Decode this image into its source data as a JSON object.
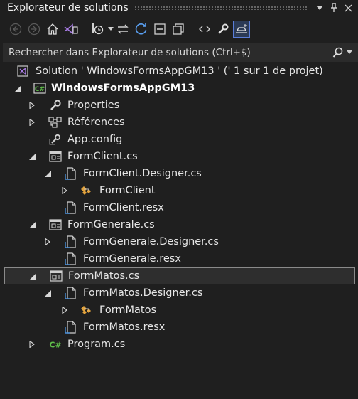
{
  "panel": {
    "title": "Explorateur de solutions"
  },
  "search": {
    "placeholder": "Rechercher dans Explorateur de solutions (Ctrl+$)"
  },
  "tree": [
    {
      "label": "Solution ' WindowsFormsAppGM13 ' (' 1 sur 1 de projet)",
      "icon": "solution-icon",
      "twisty": "none",
      "level": 0
    },
    {
      "label": "WindowsFormsAppGM13",
      "icon": "csharp-project-icon",
      "twisty": "expanded",
      "level": 0,
      "bold": true
    },
    {
      "label": "Properties",
      "icon": "wrench-icon",
      "twisty": "collapsed",
      "level": 1
    },
    {
      "label": "Références",
      "icon": "references-icon",
      "twisty": "collapsed",
      "level": 1
    },
    {
      "label": "App.config",
      "icon": "config-icon",
      "twisty": "none",
      "level": 1
    },
    {
      "label": "FormClient.cs",
      "icon": "form-icon",
      "twisty": "expanded",
      "level": 1
    },
    {
      "label": "FormClient.Designer.cs",
      "icon": "code-file-icon",
      "twisty": "expanded",
      "level": 2
    },
    {
      "label": "FormClient",
      "icon": "class-icon",
      "twisty": "collapsed",
      "level": 3
    },
    {
      "label": "FormClient.resx",
      "icon": "resx-icon",
      "twisty": "none",
      "level": 2
    },
    {
      "label": "FormGenerale.cs",
      "icon": "form-icon",
      "twisty": "expanded",
      "level": 1
    },
    {
      "label": "FormGenerale.Designer.cs",
      "icon": "code-file-icon",
      "twisty": "collapsed",
      "level": 2
    },
    {
      "label": "FormGenerale.resx",
      "icon": "resx-icon",
      "twisty": "none",
      "level": 2
    },
    {
      "label": "FormMatos.cs",
      "icon": "form-icon",
      "twisty": "expanded",
      "level": 1,
      "selected": true
    },
    {
      "label": "FormMatos.Designer.cs",
      "icon": "code-file-icon",
      "twisty": "expanded",
      "level": 2
    },
    {
      "label": "FormMatos",
      "icon": "class-icon",
      "twisty": "collapsed",
      "level": 3
    },
    {
      "label": "FormMatos.resx",
      "icon": "resx-icon",
      "twisty": "none",
      "level": 2
    },
    {
      "label": "Program.cs",
      "icon": "csharp-file-icon",
      "twisty": "collapsed",
      "level": 1
    }
  ]
}
